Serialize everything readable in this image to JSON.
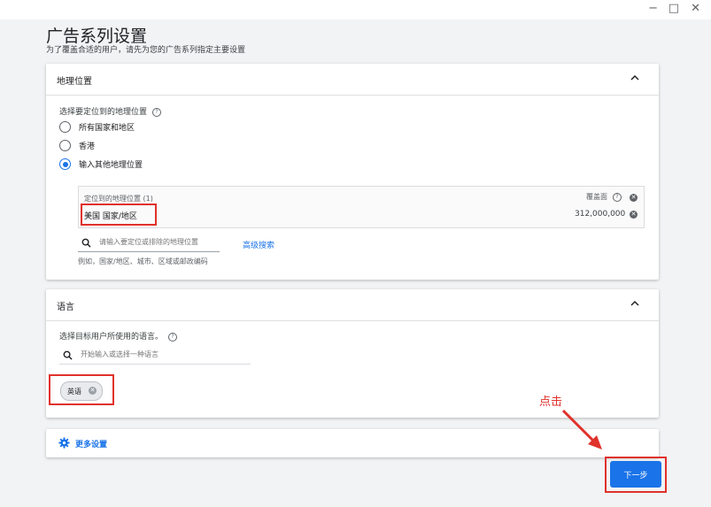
{
  "window": {
    "minimize": "−",
    "maximize": "□",
    "close": "✕"
  },
  "header": {
    "title": "广告系列设置",
    "subtitle": "为了覆盖合适的用户，请先为您的广告系列指定主要设置"
  },
  "location_card": {
    "title": "地理位置",
    "question": "选择要定位到的地理位置",
    "options": [
      {
        "label": "所有国家和地区",
        "selected": false
      },
      {
        "label": "香港",
        "selected": false
      },
      {
        "label": "输入其他地理位置",
        "selected": true
      }
    ],
    "targeted_header": "定位到的地理位置 (1)",
    "reach_header": "覆盖面",
    "targeted": [
      {
        "name": "美国 国家/地区",
        "reach": "312,000,000"
      }
    ],
    "search_placeholder": "请输入要定位或排除的地理位置",
    "search_hint": "例如，国家/地区、城市、区域或邮政编码",
    "advanced_search": "高级搜索"
  },
  "language_card": {
    "title": "语言",
    "question": "选择目标用户所使用的语言。",
    "search_placeholder": "开始输入或选择一种语言",
    "selected": [
      "英语"
    ]
  },
  "more_settings": {
    "label": "更多设置"
  },
  "annotation": {
    "text": "点击"
  },
  "footer": {
    "next_label": "下一步"
  },
  "colors": {
    "accent": "#1a73e8",
    "annotation": "#e0312b"
  }
}
